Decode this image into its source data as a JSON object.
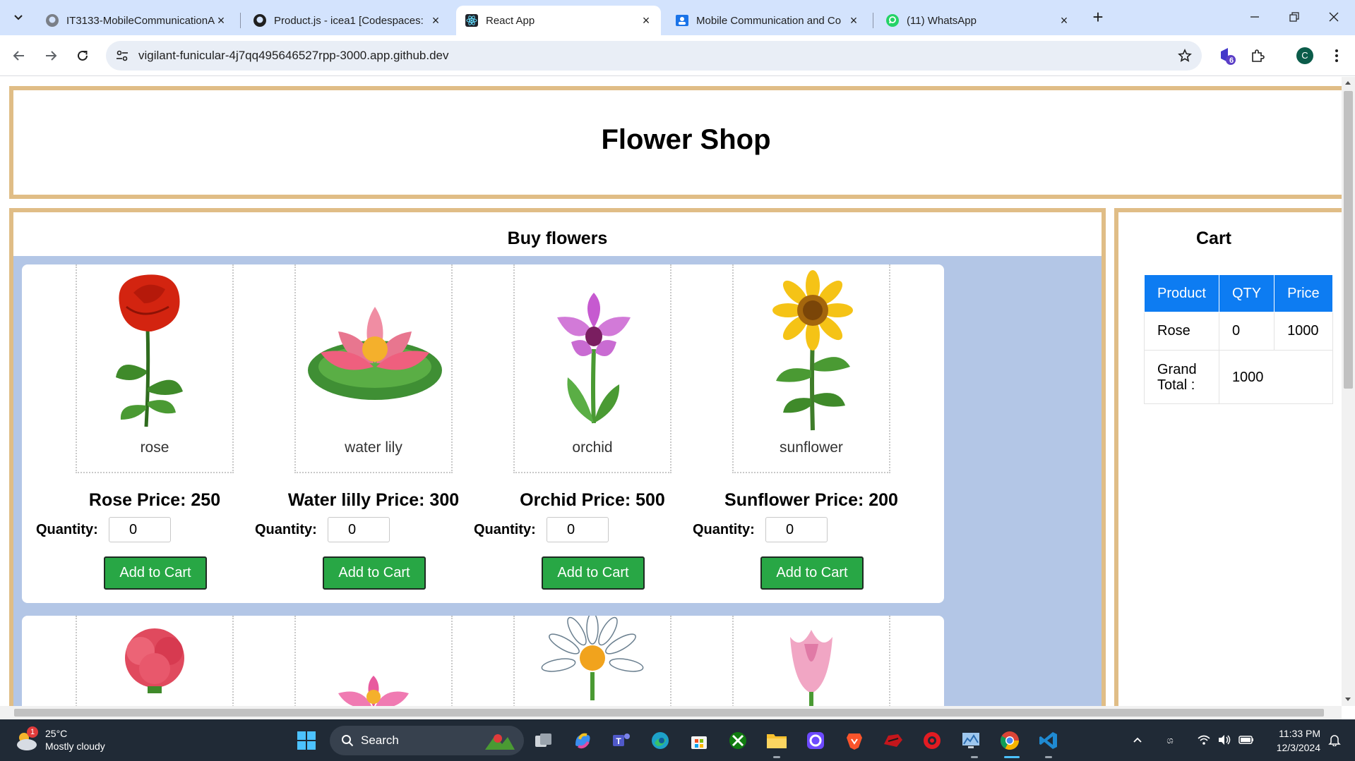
{
  "browser": {
    "tabs": [
      {
        "title": "IT3133-MobileCommunicationA",
        "icon": "github-icon",
        "active": false
      },
      {
        "title": "Product.js - icea1 [Codespaces:",
        "icon": "github-icon",
        "active": false
      },
      {
        "title": "React App",
        "icon": "react-icon",
        "active": true
      },
      {
        "title": "Mobile Communication and Co",
        "icon": "classroom-icon",
        "active": false
      },
      {
        "title": "(11) WhatsApp",
        "icon": "whatsapp-icon",
        "active": false
      }
    ],
    "url": "vigilant-funicular-4j7qq495646527rpp-3000.app.github.dev",
    "extensions_badge": "6",
    "profile_initial": "C"
  },
  "page": {
    "title": "Flower Shop",
    "products_heading": "Buy flowers",
    "quantity_label": "Quantity:",
    "add_label": "Add to Cart",
    "products": [
      {
        "caption": "rose",
        "title": "Rose Price: 250",
        "qty": "0"
      },
      {
        "caption": "water lily",
        "title": "Water lilly Price: 300",
        "qty": "0"
      },
      {
        "caption": "orchid",
        "title": "Orchid Price: 500",
        "qty": "0"
      },
      {
        "caption": "sunflower",
        "title": "Sunflower Price: 200",
        "qty": "0"
      }
    ],
    "cart": {
      "heading": "Cart",
      "columns": [
        "Product",
        "QTY",
        "Price"
      ],
      "rows": [
        {
          "product": "Rose",
          "qty": "0",
          "price": "1000"
        }
      ],
      "grand_total_label_1": "Grand",
      "grand_total_label_2": "Total :",
      "grand_total": "1000"
    },
    "colors": {
      "border": "#e0bd86",
      "grid_bg": "#b3c6e6",
      "button": "#28a745",
      "table_header": "#0d7cf2"
    }
  },
  "taskbar": {
    "weather_temp": "25°C",
    "weather_desc": "Mostly cloudy",
    "weather_badge": "1",
    "search_label": "Search",
    "time": "11:33 PM",
    "date": "12/3/2024"
  }
}
